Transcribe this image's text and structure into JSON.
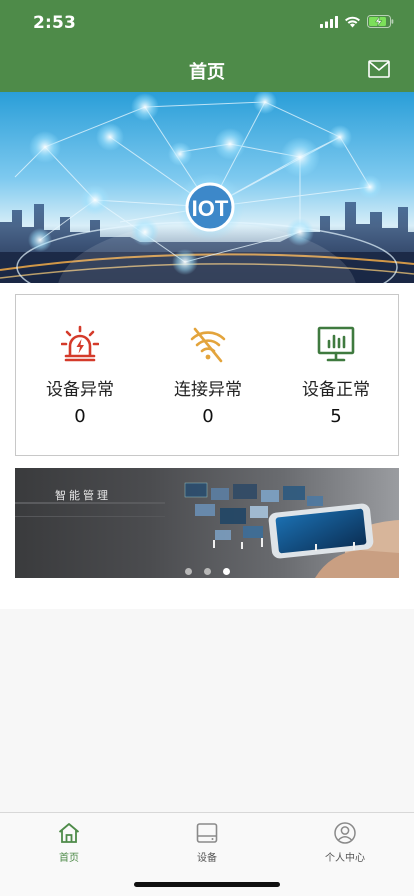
{
  "status_bar": {
    "time": "2:53"
  },
  "nav": {
    "title": "首页"
  },
  "hero": {
    "badge": "IOT"
  },
  "stats": [
    {
      "label": "设备异常",
      "value": "0",
      "icon": "alarm-light-icon",
      "color": "#d43a2a"
    },
    {
      "label": "连接异常",
      "value": "0",
      "icon": "wifi-off-icon",
      "color": "#e3a43c"
    },
    {
      "label": "设备正常",
      "value": "5",
      "icon": "monitor-chart-icon",
      "color": "#3f7a3f"
    }
  ],
  "banner": {
    "title": "智能管理",
    "slide_count": 3,
    "active_slide": 3
  },
  "tabbar": {
    "items": [
      {
        "label": "首页",
        "icon": "home-icon",
        "active": true
      },
      {
        "label": "设备",
        "icon": "device-icon",
        "active": false
      },
      {
        "label": "个人中心",
        "icon": "user-icon",
        "active": false
      }
    ]
  },
  "colors": {
    "brand": "#4e8b49",
    "tab_active": "#4e8b49",
    "tab_inactive": "#8a8a8a"
  }
}
